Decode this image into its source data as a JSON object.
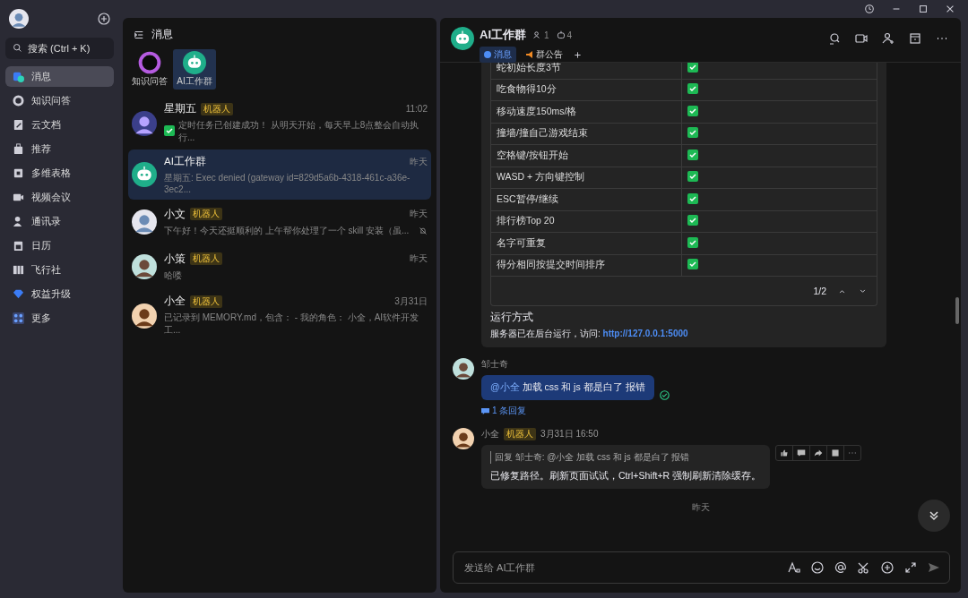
{
  "sidebar": {
    "search": {
      "placeholder": "搜索 (Ctrl + K)"
    },
    "items": [
      {
        "label": "消息",
        "selected": true
      },
      {
        "label": "知识问答",
        "selected": false
      },
      {
        "label": "云文档",
        "selected": false
      },
      {
        "label": "推荐",
        "selected": false
      },
      {
        "label": "多维表格",
        "selected": false
      },
      {
        "label": "视频会议",
        "selected": false
      },
      {
        "label": "通讯录",
        "selected": false
      },
      {
        "label": "日历",
        "selected": false
      },
      {
        "label": "飞行社",
        "selected": false
      },
      {
        "label": "权益升级",
        "selected": false
      },
      {
        "label": "更多",
        "selected": false
      }
    ]
  },
  "conversations": {
    "title": "消息",
    "pinned": [
      {
        "label": "知识问答",
        "selected": false
      },
      {
        "label": "AI工作群",
        "selected": true
      }
    ],
    "items": [
      {
        "name": "星期五",
        "bot_tag": "机器人",
        "time": "11:02",
        "preview": "定时任务已创建成功！ 从明天开始，每天早上8点整会自动执行...",
        "done_check": true,
        "muted": false,
        "selected": false
      },
      {
        "name": "AI工作群",
        "time": "昨天",
        "preview": "星期五: Exec denied (gateway id=829d5a6b-4318-461c-a36e-3ec2...",
        "done_check": false,
        "muted": false,
        "selected": true
      },
      {
        "name": "小文",
        "bot_tag": "机器人",
        "time": "昨天",
        "preview": "下午好！今天还挺顺利的 上午帮你处理了一个 skill 安装（虽...",
        "done_check": false,
        "muted": true,
        "selected": false
      },
      {
        "name": "小策",
        "bot_tag": "机器人",
        "time": "昨天",
        "preview": "哈喽",
        "done_check": false,
        "muted": false,
        "selected": false
      },
      {
        "name": "小全",
        "bot_tag": "机器人",
        "time": "3月31日",
        "preview": "已记录到 MEMORY.md，包含： - 我的角色： 小全，AI软件开发工...",
        "done_check": false,
        "muted": false,
        "selected": false
      }
    ]
  },
  "chat": {
    "title": "AI工作群",
    "members": "1",
    "bots": "4",
    "tabs": [
      {
        "label": "消息",
        "selected": true
      },
      {
        "label": "群公告",
        "selected": false
      }
    ],
    "table": {
      "rows": [
        {
          "label": "蛇初始长度3节",
          "checked": true
        },
        {
          "label": "吃食物得10分",
          "checked": true
        },
        {
          "label": "移动速度150ms/格",
          "checked": true
        },
        {
          "label": "撞墙/撞自己游戏结束",
          "checked": true
        },
        {
          "label": "空格键/按钮开始",
          "checked": true
        },
        {
          "label": "WASD + 方向键控制",
          "checked": true
        },
        {
          "label": "ESC暂停/继续",
          "checked": true
        },
        {
          "label": "排行榜Top 20",
          "checked": true
        },
        {
          "label": "名字可重复",
          "checked": true
        },
        {
          "label": "得分相同按提交时间排序",
          "checked": true
        }
      ],
      "page": "1/2"
    },
    "run_heading": "运行方式",
    "run_text": "服务器已在后台运行，访问: ",
    "run_link": "http://127.0.0.1:5000",
    "msg1": {
      "sender": "邹士奇",
      "mention": "@小全",
      "text": "加载 css  和 js  都是白了 报错",
      "replies": "1 条回复",
      "read": true
    },
    "msg2": {
      "sender": "小全",
      "bot_tag": "机器人",
      "time": "3月31日 16:50",
      "quote": "回复 邹士奇: @小全 加载 css 和 js 都是白了 报错",
      "text": "已修复路径。刷新页面试试，Ctrl+Shift+R 强制刷新清除缓存。"
    },
    "divider": "昨天",
    "input": {
      "placeholder": "发送给 AI工作群"
    }
  }
}
